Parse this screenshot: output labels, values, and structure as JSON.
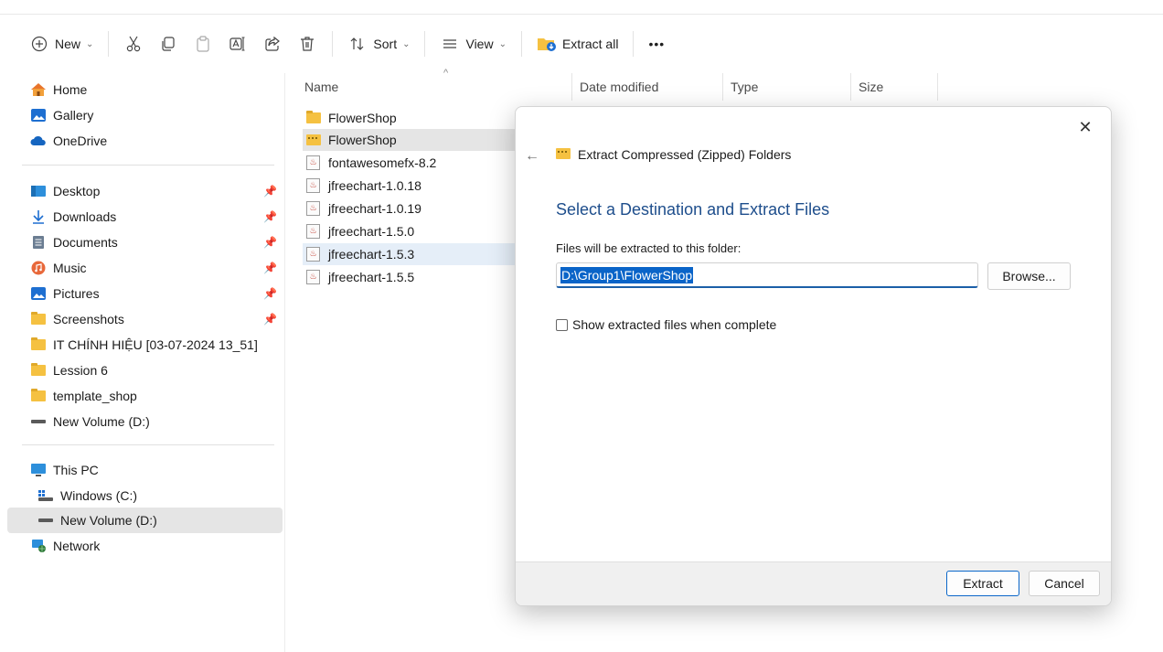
{
  "toolbar": {
    "new_label": "New",
    "sort_label": "Sort",
    "view_label": "View",
    "extract_all_label": "Extract all",
    "more_label": "•••"
  },
  "sidebar": {
    "items": [
      {
        "label": "Home",
        "icon": "home-icon"
      },
      {
        "label": "Gallery",
        "icon": "gallery-icon"
      },
      {
        "label": "OneDrive",
        "icon": "cloud-icon"
      },
      {
        "label": "Desktop",
        "icon": "desktop-icon",
        "pinned": true
      },
      {
        "label": "Downloads",
        "icon": "download-icon",
        "pinned": true
      },
      {
        "label": "Documents",
        "icon": "documents-icon",
        "pinned": true
      },
      {
        "label": "Music",
        "icon": "music-icon",
        "pinned": true
      },
      {
        "label": "Pictures",
        "icon": "pictures-icon",
        "pinned": true
      },
      {
        "label": "Screenshots",
        "icon": "folder-icon",
        "pinned": true
      },
      {
        "label": "IT CHÍNH HIỆU [03-07-2024 13_51]",
        "icon": "folder-icon"
      },
      {
        "label": "Lession 6",
        "icon": "folder-icon"
      },
      {
        "label": "template_shop",
        "icon": "folder-icon"
      },
      {
        "label": "New Volume (D:)",
        "icon": "drive-icon"
      },
      {
        "label": "This PC",
        "icon": "pc-icon"
      },
      {
        "label": "Windows (C:)",
        "icon": "windows-drive-icon"
      },
      {
        "label": "New Volume (D:)",
        "icon": "drive-icon",
        "selected": true
      },
      {
        "label": "Network",
        "icon": "network-icon"
      }
    ],
    "pin_glyph": "📌"
  },
  "columns": {
    "name": "Name",
    "date": "Date modified",
    "type": "Type",
    "size": "Size"
  },
  "files": [
    {
      "name": "FlowerShop",
      "kind": "folder"
    },
    {
      "name": "FlowerShop",
      "kind": "zip",
      "state": "selected"
    },
    {
      "name": "fontawesomefx-8.2",
      "kind": "jar"
    },
    {
      "name": "jfreechart-1.0.18",
      "kind": "jar"
    },
    {
      "name": "jfreechart-1.0.19",
      "kind": "jar"
    },
    {
      "name": "jfreechart-1.5.0",
      "kind": "jar"
    },
    {
      "name": "jfreechart-1.5.3",
      "kind": "jar",
      "state": "hover"
    },
    {
      "name": "jfreechart-1.5.5",
      "kind": "jar"
    }
  ],
  "dialog": {
    "title": "Extract Compressed (Zipped) Folders",
    "heading": "Select a Destination and Extract Files",
    "folder_label": "Files will be extracted to this folder:",
    "path_value": "D:\\Group1\\FlowerShop",
    "browse_label": "Browse...",
    "checkbox_label": "Show extracted files when complete",
    "checkbox_checked": false,
    "extract_label": "Extract",
    "cancel_label": "Cancel",
    "close_glyph": "✕",
    "back_glyph": "←"
  },
  "colors": {
    "accent": "#0a64c8",
    "heading": "#1e4e8c",
    "selection_grey": "#e5e5e5",
    "selection_blue": "#e5eef8"
  }
}
